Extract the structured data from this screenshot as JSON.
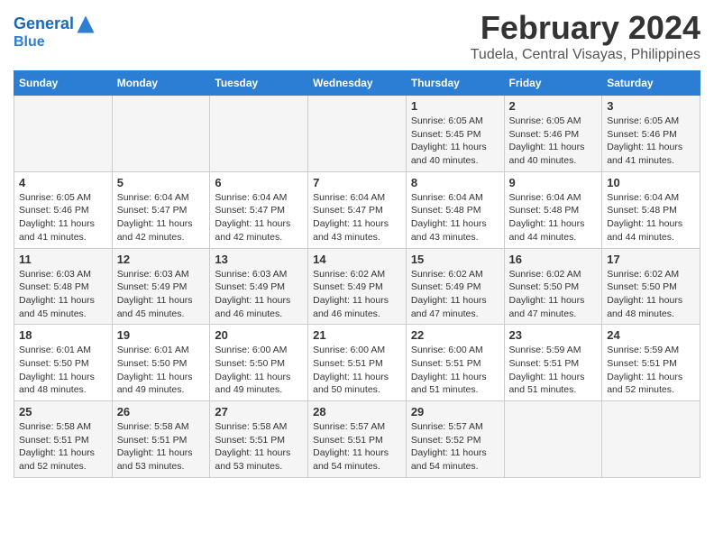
{
  "header": {
    "logo_line1": "General",
    "logo_line2": "Blue",
    "title": "February 2024",
    "subtitle": "Tudela, Central Visayas, Philippines"
  },
  "days_of_week": [
    "Sunday",
    "Monday",
    "Tuesday",
    "Wednesday",
    "Thursday",
    "Friday",
    "Saturday"
  ],
  "weeks": [
    [
      {
        "day": "",
        "info": ""
      },
      {
        "day": "",
        "info": ""
      },
      {
        "day": "",
        "info": ""
      },
      {
        "day": "",
        "info": ""
      },
      {
        "day": "1",
        "info": "Sunrise: 6:05 AM\nSunset: 5:45 PM\nDaylight: 11 hours and 40 minutes."
      },
      {
        "day": "2",
        "info": "Sunrise: 6:05 AM\nSunset: 5:46 PM\nDaylight: 11 hours and 40 minutes."
      },
      {
        "day": "3",
        "info": "Sunrise: 6:05 AM\nSunset: 5:46 PM\nDaylight: 11 hours and 41 minutes."
      }
    ],
    [
      {
        "day": "4",
        "info": "Sunrise: 6:05 AM\nSunset: 5:46 PM\nDaylight: 11 hours and 41 minutes."
      },
      {
        "day": "5",
        "info": "Sunrise: 6:04 AM\nSunset: 5:47 PM\nDaylight: 11 hours and 42 minutes."
      },
      {
        "day": "6",
        "info": "Sunrise: 6:04 AM\nSunset: 5:47 PM\nDaylight: 11 hours and 42 minutes."
      },
      {
        "day": "7",
        "info": "Sunrise: 6:04 AM\nSunset: 5:47 PM\nDaylight: 11 hours and 43 minutes."
      },
      {
        "day": "8",
        "info": "Sunrise: 6:04 AM\nSunset: 5:48 PM\nDaylight: 11 hours and 43 minutes."
      },
      {
        "day": "9",
        "info": "Sunrise: 6:04 AM\nSunset: 5:48 PM\nDaylight: 11 hours and 44 minutes."
      },
      {
        "day": "10",
        "info": "Sunrise: 6:04 AM\nSunset: 5:48 PM\nDaylight: 11 hours and 44 minutes."
      }
    ],
    [
      {
        "day": "11",
        "info": "Sunrise: 6:03 AM\nSunset: 5:48 PM\nDaylight: 11 hours and 45 minutes."
      },
      {
        "day": "12",
        "info": "Sunrise: 6:03 AM\nSunset: 5:49 PM\nDaylight: 11 hours and 45 minutes."
      },
      {
        "day": "13",
        "info": "Sunrise: 6:03 AM\nSunset: 5:49 PM\nDaylight: 11 hours and 46 minutes."
      },
      {
        "day": "14",
        "info": "Sunrise: 6:02 AM\nSunset: 5:49 PM\nDaylight: 11 hours and 46 minutes."
      },
      {
        "day": "15",
        "info": "Sunrise: 6:02 AM\nSunset: 5:49 PM\nDaylight: 11 hours and 47 minutes."
      },
      {
        "day": "16",
        "info": "Sunrise: 6:02 AM\nSunset: 5:50 PM\nDaylight: 11 hours and 47 minutes."
      },
      {
        "day": "17",
        "info": "Sunrise: 6:02 AM\nSunset: 5:50 PM\nDaylight: 11 hours and 48 minutes."
      }
    ],
    [
      {
        "day": "18",
        "info": "Sunrise: 6:01 AM\nSunset: 5:50 PM\nDaylight: 11 hours and 48 minutes."
      },
      {
        "day": "19",
        "info": "Sunrise: 6:01 AM\nSunset: 5:50 PM\nDaylight: 11 hours and 49 minutes."
      },
      {
        "day": "20",
        "info": "Sunrise: 6:00 AM\nSunset: 5:50 PM\nDaylight: 11 hours and 49 minutes."
      },
      {
        "day": "21",
        "info": "Sunrise: 6:00 AM\nSunset: 5:51 PM\nDaylight: 11 hours and 50 minutes."
      },
      {
        "day": "22",
        "info": "Sunrise: 6:00 AM\nSunset: 5:51 PM\nDaylight: 11 hours and 51 minutes."
      },
      {
        "day": "23",
        "info": "Sunrise: 5:59 AM\nSunset: 5:51 PM\nDaylight: 11 hours and 51 minutes."
      },
      {
        "day": "24",
        "info": "Sunrise: 5:59 AM\nSunset: 5:51 PM\nDaylight: 11 hours and 52 minutes."
      }
    ],
    [
      {
        "day": "25",
        "info": "Sunrise: 5:58 AM\nSunset: 5:51 PM\nDaylight: 11 hours and 52 minutes."
      },
      {
        "day": "26",
        "info": "Sunrise: 5:58 AM\nSunset: 5:51 PM\nDaylight: 11 hours and 53 minutes."
      },
      {
        "day": "27",
        "info": "Sunrise: 5:58 AM\nSunset: 5:51 PM\nDaylight: 11 hours and 53 minutes."
      },
      {
        "day": "28",
        "info": "Sunrise: 5:57 AM\nSunset: 5:51 PM\nDaylight: 11 hours and 54 minutes."
      },
      {
        "day": "29",
        "info": "Sunrise: 5:57 AM\nSunset: 5:52 PM\nDaylight: 11 hours and 54 minutes."
      },
      {
        "day": "",
        "info": ""
      },
      {
        "day": "",
        "info": ""
      }
    ]
  ]
}
